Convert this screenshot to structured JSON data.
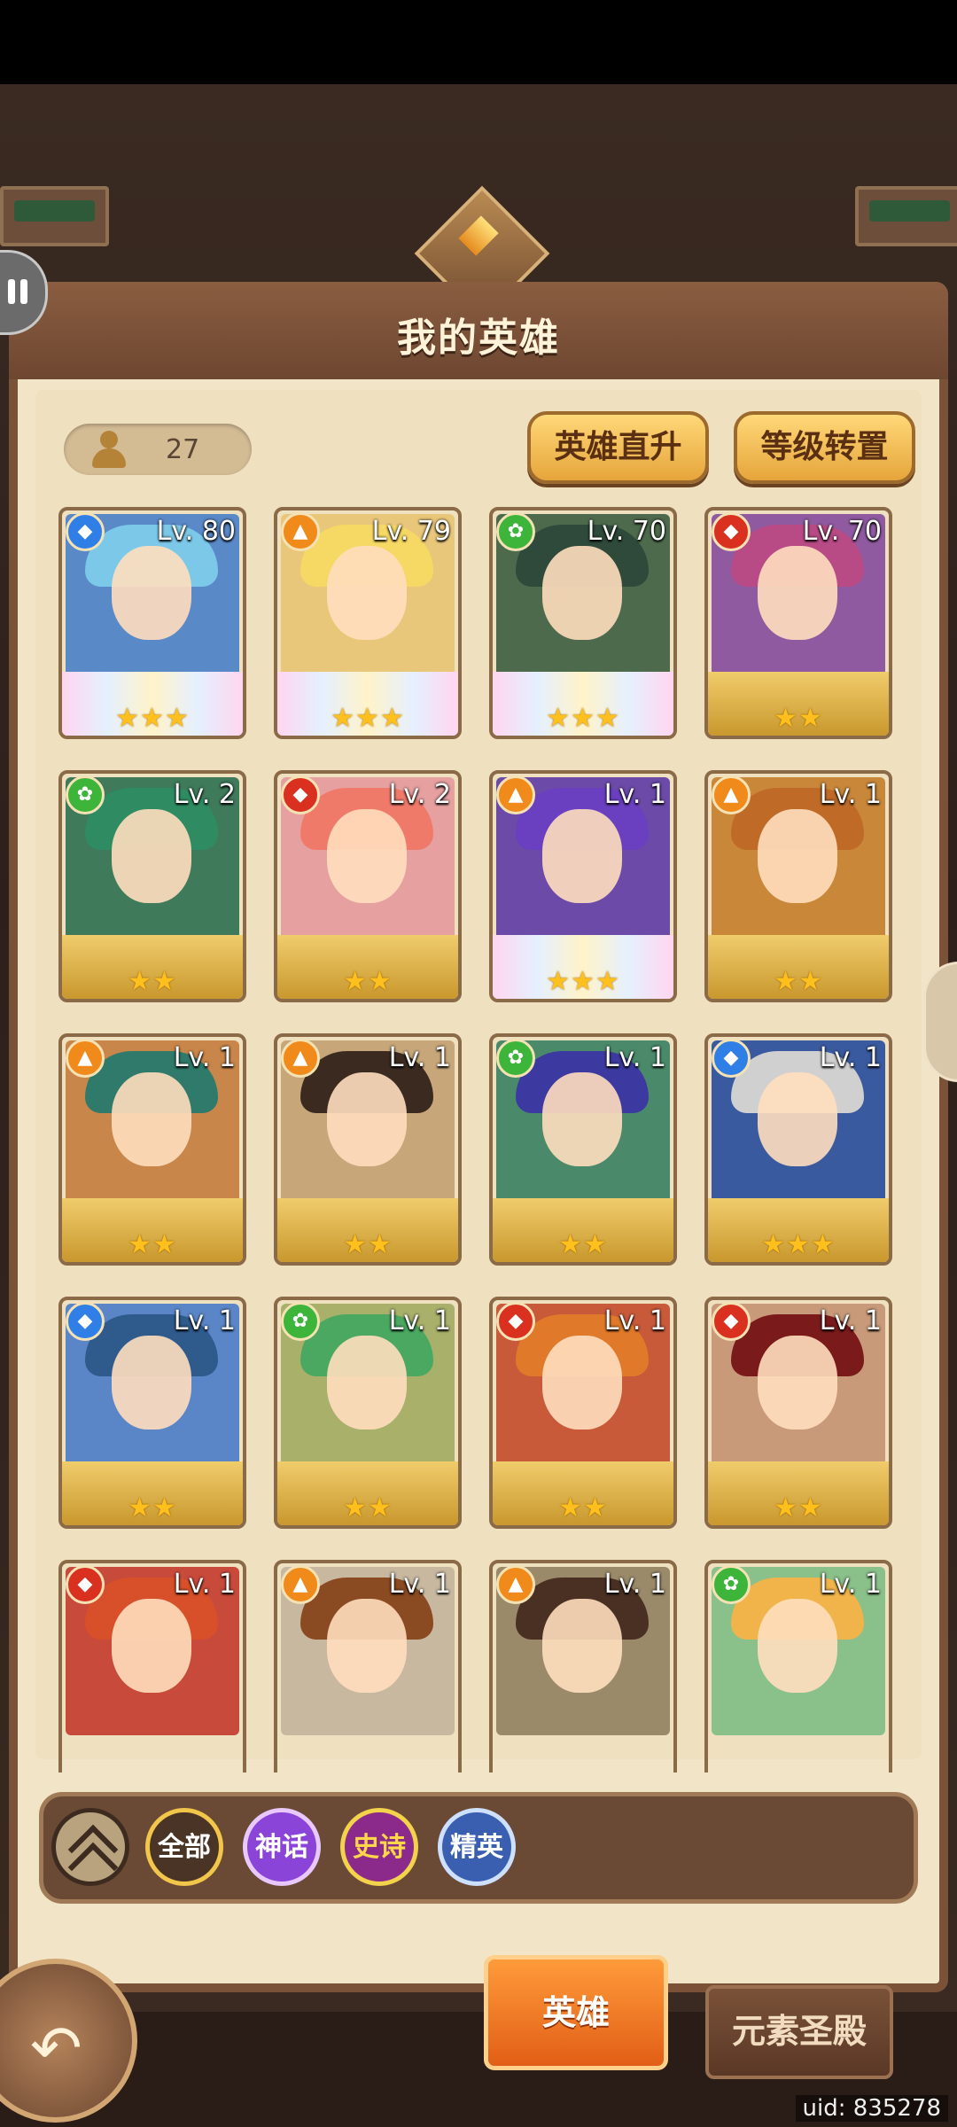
{
  "header": {
    "title": "我的英雄"
  },
  "hero_count": "27",
  "buttons": {
    "direct_upgrade": "英雄直升",
    "level_transfer": "等级转置"
  },
  "heroes": [
    {
      "level": "Lv. 80",
      "stars": "★★★",
      "element": "water",
      "element_color": "#2f7fe6",
      "tier": "rainbow",
      "bg": "#5a89c8",
      "hair": "#7cc8e8"
    },
    {
      "level": "Lv. 79",
      "stars": "★★★",
      "element": "fire",
      "element_color": "#f08a1a",
      "tier": "rainbow",
      "bg": "#e9c77a",
      "hair": "#f6d864"
    },
    {
      "level": "Lv. 70",
      "stars": "★★★",
      "element": "wind",
      "element_color": "#3db43a",
      "tier": "rainbow",
      "bg": "#4e6a4c",
      "hair": "#2f4a3a"
    },
    {
      "level": "Lv. 70",
      "stars": "★★",
      "element": "flame",
      "element_color": "#d93020",
      "tier": "gold",
      "bg": "#8f5aa0",
      "hair": "#b84a86"
    },
    {
      "level": "Lv. 2",
      "stars": "★★",
      "element": "wind",
      "element_color": "#3db43a",
      "tier": "gold",
      "bg": "#3f7a5a",
      "hair": "#2f8c62"
    },
    {
      "level": "Lv. 2",
      "stars": "★★",
      "element": "flame",
      "element_color": "#d93020",
      "tier": "gold",
      "bg": "#e6a0a0",
      "hair": "#f07a6a"
    },
    {
      "level": "Lv. 1",
      "stars": "★★★",
      "element": "fire",
      "element_color": "#f08a1a",
      "tier": "rainbow",
      "bg": "#6b4aa8",
      "hair": "#6a3fc0"
    },
    {
      "level": "Lv. 1",
      "stars": "★★",
      "element": "fire",
      "element_color": "#f08a1a",
      "tier": "gold",
      "bg": "#c9873a",
      "hair": "#c06a28"
    },
    {
      "level": "Lv. 1",
      "stars": "★★",
      "element": "fire",
      "element_color": "#f08a1a",
      "tier": "gold",
      "bg": "#c9864a",
      "hair": "#2f7a6a"
    },
    {
      "level": "Lv. 1",
      "stars": "★★",
      "element": "fire",
      "element_color": "#f08a1a",
      "tier": "gold",
      "bg": "#c7a77a",
      "hair": "#3b2a20"
    },
    {
      "level": "Lv. 1",
      "stars": "★★",
      "element": "wind",
      "element_color": "#3db43a",
      "tier": "gold",
      "bg": "#4a8a6a",
      "hair": "#3c3aa0"
    },
    {
      "level": "Lv. 1",
      "stars": "★★★",
      "element": "water",
      "element_color": "#2f7fe6",
      "tier": "gold",
      "bg": "#3a5aa0",
      "hair": "#d0d0d0"
    },
    {
      "level": "Lv. 1",
      "stars": "★★",
      "element": "water",
      "element_color": "#2f7fe6",
      "tier": "gold",
      "bg": "#5a86c8",
      "hair": "#2f5a8c"
    },
    {
      "level": "Lv. 1",
      "stars": "★★",
      "element": "wind",
      "element_color": "#3db43a",
      "tier": "gold",
      "bg": "#a8b06a",
      "hair": "#4aa860"
    },
    {
      "level": "Lv. 1",
      "stars": "★★",
      "element": "flame",
      "element_color": "#d93020",
      "tier": "gold",
      "bg": "#c85a3a",
      "hair": "#e07a2a"
    },
    {
      "level": "Lv. 1",
      "stars": "★★",
      "element": "flame",
      "element_color": "#d93020",
      "tier": "gold",
      "bg": "#c89a7a",
      "hair": "#7a1a1a"
    },
    {
      "level": "Lv. 1",
      "stars": "★★",
      "element": "flame",
      "element_color": "#d93020",
      "tier": "gold",
      "bg": "#c84a3a",
      "hair": "#d8502a"
    },
    {
      "level": "Lv. 1",
      "stars": "★★★",
      "element": "fire",
      "element_color": "#f08a1a",
      "tier": "silver",
      "bg": "#c8b8a0",
      "hair": "#8a4a22"
    },
    {
      "level": "Lv. 1",
      "stars": "★★★",
      "element": "fire",
      "element_color": "#f08a1a",
      "tier": "silver",
      "bg": "#9a8a6a",
      "hair": "#4a3022"
    },
    {
      "level": "Lv. 1",
      "stars": "★★★",
      "element": "wind",
      "element_color": "#3db43a",
      "tier": "silver",
      "bg": "#8ac08a",
      "hair": "#f0b44a"
    }
  ],
  "filters": [
    {
      "label": "全部",
      "bg": "#4a3426",
      "border": "#f2c64a",
      "color": "#ffffff"
    },
    {
      "label": "神话",
      "bg": "#8a44d8",
      "border": "#e9c8ff",
      "color": "#ffffff"
    },
    {
      "label": "史诗",
      "bg": "#8c2a8c",
      "border": "#f3d24c",
      "color": "#ffd84a"
    },
    {
      "label": "精英",
      "bg": "#3a5fb0",
      "border": "#cde0ff",
      "color": "#ffffff"
    }
  ],
  "tabs": {
    "heroes": "英雄",
    "temple": "元素圣殿"
  },
  "uid": "uid: 835278"
}
